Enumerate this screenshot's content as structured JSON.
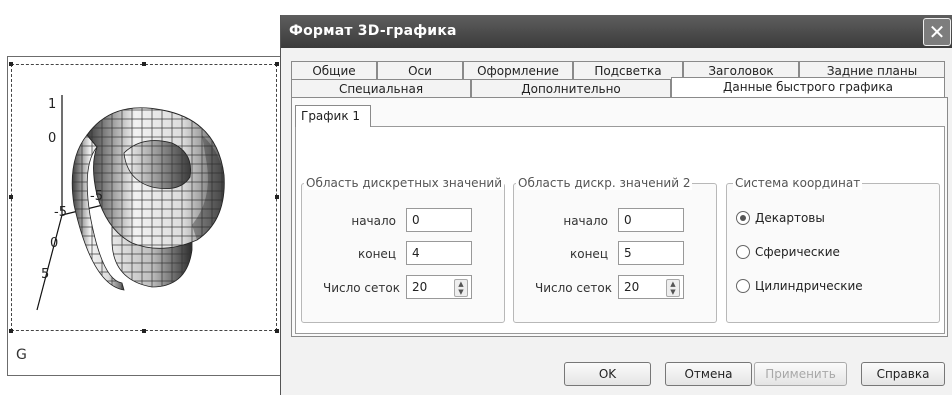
{
  "plot": {
    "ticks": {
      "z1": "1",
      "z0": "0",
      "a1": "-5",
      "a2": "-5",
      "b0": "0",
      "b5": "5"
    },
    "variable": "G"
  },
  "dialog": {
    "title": "Формат 3D-графика",
    "close": "✕",
    "tabs_row1": [
      "Общие",
      "Оси",
      "Оформление",
      "Подсветка",
      "Заголовок",
      "Задние планы"
    ],
    "tabs_row2": [
      "Специальная",
      "Дополнительно",
      "Данные быстрого графика"
    ],
    "subtab": "График 1",
    "group1": {
      "title": "Область дискретных значений",
      "start_label": "начало",
      "start_value": "0",
      "end_label": "конец",
      "end_value": "4",
      "grid_label": "Число сеток",
      "grid_value": "20"
    },
    "group2": {
      "title": "Область дискр. значений 2",
      "start_label": "начало",
      "start_value": "0",
      "end_label": "конец",
      "end_value": "5",
      "grid_label": "Число сеток",
      "grid_value": "20"
    },
    "group3": {
      "title": "Система координат",
      "options": [
        "Декартовы",
        "Сферические",
        "Цилиндрические"
      ],
      "selected": "Декартовы"
    },
    "buttons": {
      "ok": "OK",
      "cancel": "Отмена",
      "apply": "Применить",
      "help": "Справка"
    }
  },
  "colors": {
    "titlebar": "#4a4a4a",
    "surface_light": "#f0f0f0",
    "surface_dark": "#3a3a3a"
  }
}
